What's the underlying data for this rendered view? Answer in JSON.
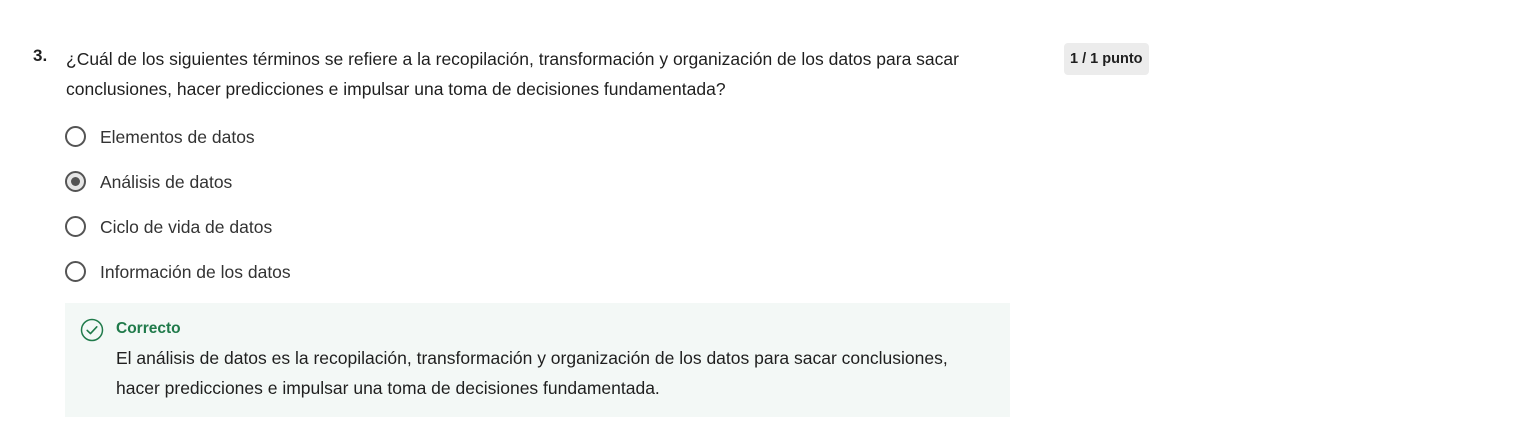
{
  "question": {
    "number": "3.",
    "text": "¿Cuál de los siguientes términos se refiere a la recopilación, transformación y organización de los datos para sacar conclusiones, hacer predicciones e impulsar una toma de decisiones fundamentada?",
    "points": "1 / 1 punto"
  },
  "options": [
    {
      "label": "Elementos de datos",
      "selected": false
    },
    {
      "label": "Análisis de datos",
      "selected": true
    },
    {
      "label": "Ciclo de vida de datos",
      "selected": false
    },
    {
      "label": "Información de los datos",
      "selected": false
    }
  ],
  "feedback": {
    "status": "Correcto",
    "icon": "check-circle-icon",
    "color": "#1f7a4a",
    "text": "El análisis de datos es la recopilación, transformación y organización de los datos para sacar conclusiones, hacer predicciones e impulsar una toma de decisiones fundamentada."
  }
}
